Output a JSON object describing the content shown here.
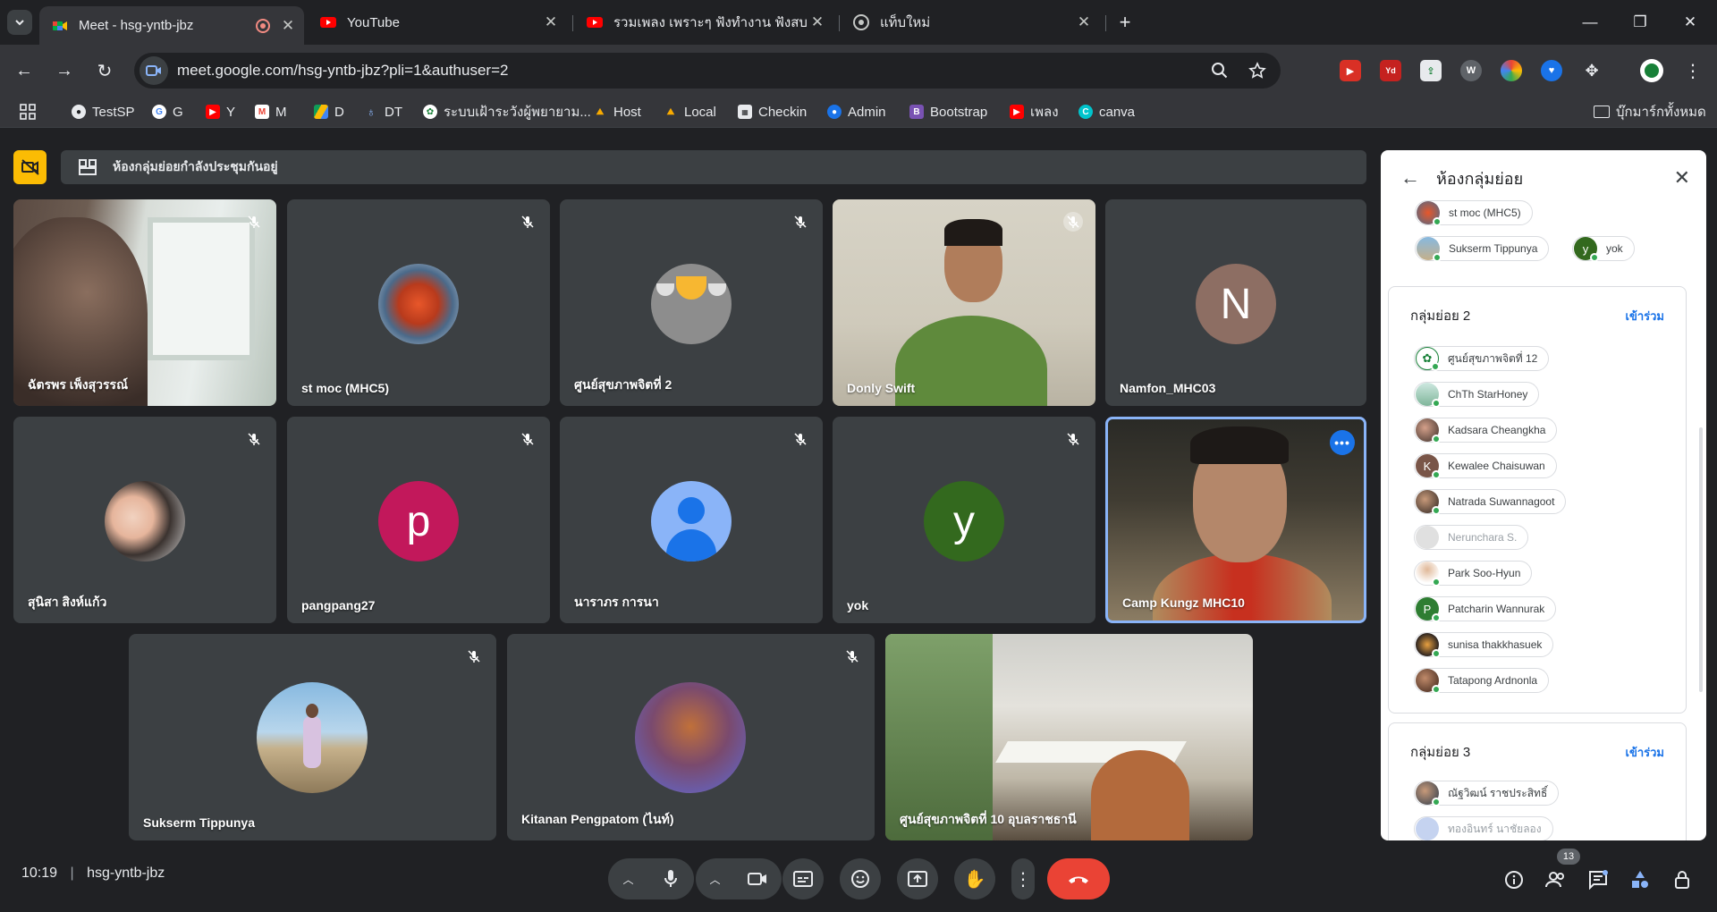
{
  "browser": {
    "tabs": [
      {
        "title": "Meet - hsg-yntb-jbz",
        "icon": "google-meet-icon",
        "active": true
      },
      {
        "title": "YouTube",
        "icon": "youtube-icon"
      },
      {
        "title": "รวมเพลง เพราะๆ ฟังทำงาน ฟังสบาย",
        "icon": "youtube-icon"
      },
      {
        "title": "แท็บใหม่",
        "icon": "chrome-icon"
      }
    ],
    "url": "meet.google.com/hsg-yntb-jbz?pli=1&authuser=2",
    "bookmarks": [
      {
        "label": "TestSP"
      },
      {
        "label": "G"
      },
      {
        "label": "Y"
      },
      {
        "label": "M"
      },
      {
        "label": "D"
      },
      {
        "label": "DT"
      },
      {
        "label": "ระบบเฝ้าระวังผู้พยายาม..."
      },
      {
        "label": "Host"
      },
      {
        "label": "Local"
      },
      {
        "label": "Checkin"
      },
      {
        "label": "Admin"
      },
      {
        "label": "Bootstrap"
      },
      {
        "label": "เพลง"
      },
      {
        "label": "canva"
      }
    ],
    "all_bookmarks": "บุ๊กมาร์กทั้งหมด"
  },
  "meet": {
    "banner": "ห้องกลุ่มย่อยกำลังประชุมกันอยู่",
    "tiles": [
      {
        "name": "ฉัตรพร เพ็งสุวรรณ์"
      },
      {
        "name": "st moc (MHC5)"
      },
      {
        "name": "ศูนย์สุขภาพจิตที่ 2"
      },
      {
        "name": "Donly Swift"
      },
      {
        "name": "Namfon_MHC03",
        "initial": "N"
      },
      {
        "name": "สุนิสา สิงห์แก้ว"
      },
      {
        "name": "pangpang27",
        "initial": "p"
      },
      {
        "name": "นาราภร การนา"
      },
      {
        "name": "yok",
        "initial": "y"
      },
      {
        "name": "Camp Kungz MHC10"
      },
      {
        "name": "Sukserm Tippunya"
      },
      {
        "name": "Kitanan Pengpatom (ไนท์)"
      },
      {
        "name": "ศูนย์สุขภาพจิตที่ 10 อุบลราชธานี"
      }
    ]
  },
  "panel": {
    "title": "ห้องกลุ่มย่อย",
    "group1_members": [
      {
        "name": "st moc (MHC5)"
      },
      {
        "name": "Sukserm Tippunya"
      },
      {
        "name": "yok",
        "initial": "y"
      }
    ],
    "group2": {
      "name": "กลุ่มย่อย 2",
      "join": "เข้าร่วม",
      "members": [
        {
          "name": "ศูนย์สุขภาพจิตที่ 12"
        },
        {
          "name": "ChTh StarHoney"
        },
        {
          "name": "Kadsara Cheangkha"
        },
        {
          "name": "Kewalee Chaisuwan",
          "initial": "K"
        },
        {
          "name": "Natrada Suwannagoot"
        },
        {
          "name": "Nerunchara S."
        },
        {
          "name": "Park Soo-Hyun"
        },
        {
          "name": "Patcharin Wannurak",
          "initial": "P"
        },
        {
          "name": "sunisa thakkhasuek"
        },
        {
          "name": "Tatapong Ardnonla"
        }
      ]
    },
    "group3": {
      "name": "กลุ่มย่อย 3",
      "join": "เข้าร่วม",
      "members": [
        {
          "name": "ณัฐวิฒน์ ราชประสิทธิ์"
        },
        {
          "name": "ทองอินทร์ นาชัยลอง"
        }
      ]
    }
  },
  "bottombar": {
    "time": "10:19",
    "meeting_code": "hsg-yntb-jbz",
    "participant_count": "13"
  },
  "colors": {
    "meet_bg": "#202124",
    "tile_bg": "#3c4043",
    "accent_blue": "#1a73e8",
    "end_call_red": "#ea4335",
    "camera_warning": "#fbbc04"
  }
}
